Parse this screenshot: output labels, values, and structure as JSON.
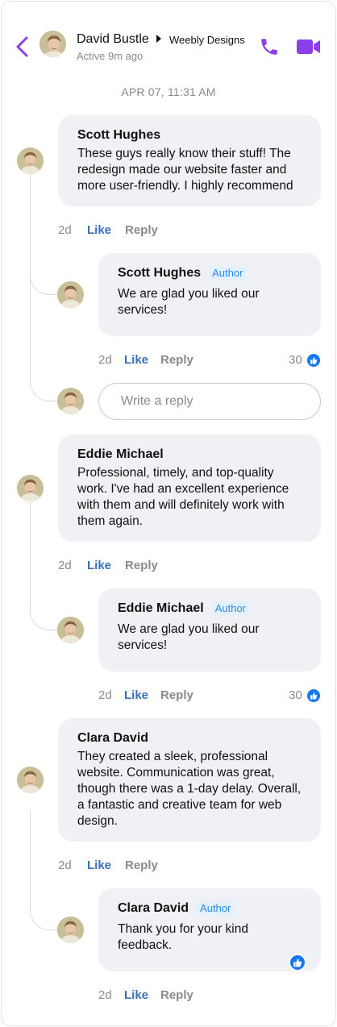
{
  "header": {
    "contact_name": "David Bustle",
    "page_name": "Weebly Designs",
    "status": "Active 9m ago",
    "icons": {
      "back": "chevron-left-icon",
      "phone": "phone-icon",
      "video": "video-camera-icon"
    },
    "accent_color": "#8b3fe8"
  },
  "date_divider": "APR 07, 11:31 AM",
  "threads": [
    {
      "comment": {
        "author": "Scott Hughes",
        "text": "These guys really know their stuff! The redesign made our website faster and more user-friendly. I highly recommend",
        "time": "2d",
        "like_label": "Like",
        "reply_label": "Reply"
      },
      "reply": {
        "author": "Scott Hughes",
        "badge": "Author",
        "text": "We are glad you liked our services!",
        "time": "2d",
        "like_label": "Like",
        "reply_label": "Reply",
        "like_count": "30"
      },
      "reply_input": {
        "placeholder": "Write a reply"
      }
    },
    {
      "comment": {
        "author": "Eddie Michael",
        "text": "Professional, timely, and top-quality work. I've had an excellent experience with them and will definitely work with them again.",
        "time": "2d",
        "like_label": "Like",
        "reply_label": "Reply"
      },
      "reply": {
        "author": "Eddie Michael",
        "badge": "Author",
        "text": "We are glad you liked our services!",
        "time": "2d",
        "like_label": "Like",
        "reply_label": "Reply",
        "like_count": "30"
      }
    },
    {
      "comment": {
        "author": "Clara David",
        "text": "They created a sleek, professional website. Communication was great, though there was a 1-day delay. Overall, a fantastic and creative team for web design.",
        "time": "2d",
        "like_label": "Like",
        "reply_label": "Reply"
      },
      "reply": {
        "author": "Clara David",
        "badge": "Author",
        "text": "Thank you for your kind feedback.",
        "time": "2d",
        "like_label": "Like",
        "reply_label": "Reply"
      }
    }
  ],
  "colors": {
    "like": "#3b6fb6",
    "muted": "#8a8a8a",
    "bubble": "#f0f1f4",
    "badge_bg": "#e3f0fd",
    "badge_text": "#2f8ae0",
    "thumb": "#1877f2"
  }
}
